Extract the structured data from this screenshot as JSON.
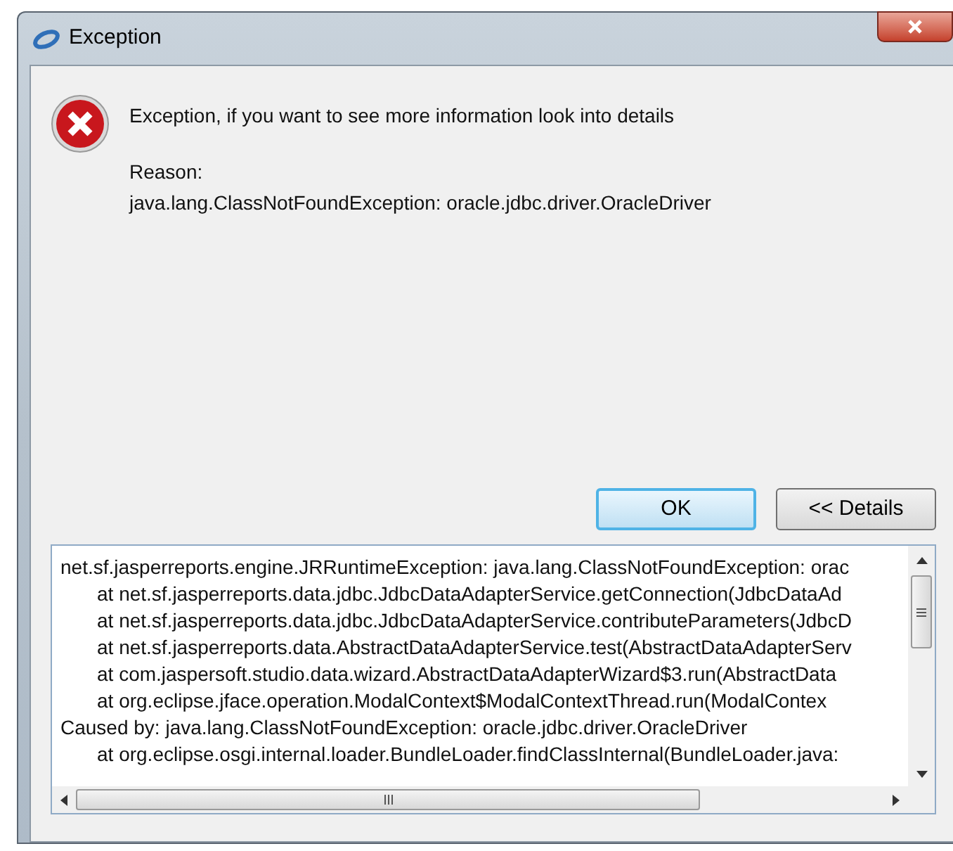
{
  "window": {
    "title": "Exception"
  },
  "message": "Exception, if you want to see more information look into details",
  "reason_label": "Reason:",
  "reason": "java.lang.ClassNotFoundException: oracle.jdbc.driver.OracleDriver",
  "buttons": [
    {
      "label": "OK",
      "default": true
    },
    {
      "label": "<< Details",
      "default": false
    }
  ],
  "details": [
    {
      "kind": "header",
      "text": "net.sf.jasperreports.engine.JRRuntimeException: java.lang.ClassNotFoundException: orac"
    },
    {
      "kind": "frame",
      "text": "at net.sf.jasperreports.data.jdbc.JdbcDataAdapterService.getConnection(JdbcDataAd"
    },
    {
      "kind": "frame",
      "text": "at net.sf.jasperreports.data.jdbc.JdbcDataAdapterService.contributeParameters(JdbcD"
    },
    {
      "kind": "frame",
      "text": "at net.sf.jasperreports.data.AbstractDataAdapterService.test(AbstractDataAdapterServ"
    },
    {
      "kind": "frame",
      "text": "at com.jaspersoft.studio.data.wizard.AbstractDataAdapterWizard$3.run(AbstractData"
    },
    {
      "kind": "frame",
      "text": "at org.eclipse.jface.operation.ModalContext$ModalContextThread.run(ModalContex"
    },
    {
      "kind": "header",
      "text": "Caused by: java.lang.ClassNotFoundException: oracle.jdbc.driver.OracleDriver"
    },
    {
      "kind": "frame",
      "text": "at org.eclipse.osgi.internal.loader.BundleLoader.findClassInternal(BundleLoader.java:"
    }
  ]
}
